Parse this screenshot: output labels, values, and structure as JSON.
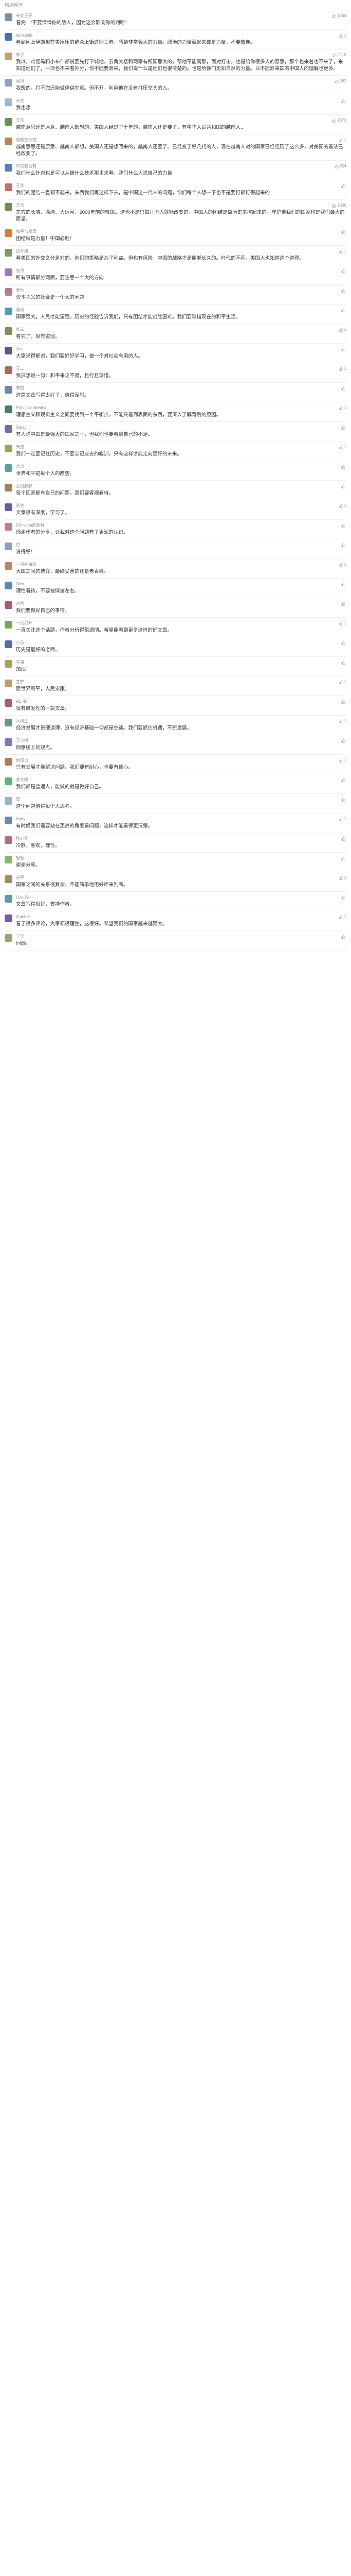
{
  "header": {
    "title": "精选留言"
  },
  "comments": [
    {
      "name": "寺文王子",
      "likes": "1844",
      "text": "看完：“不要憎惮你的敌人，因为这会影响你的判断”",
      "avatar_color": "#7d8fa3"
    },
    {
      "name": "sunkesta",
      "likes": "1",
      "text": "看到网上伊朗那些美压压的群众上街送别亡者，感到非常强大的力量。政治的力量藏起来都是力量，不要放弃。",
      "avatar_color": "#4a6fa5"
    },
    {
      "name": "郭子",
      "likes": "1118",
      "text": "我以，难怪马和小布什都说要先打下城地，五角大楼和两家有所国那大的，帮他不能离那，面对打击。也是给你很多人的原意，那个也来着也不来了，来知道他们了，一项也不来看外分，你不能要准来，我们说什么是他们也很清楚的。也是给你们无知自然的力量。以不能准来国的中国人的理解也更多。",
      "avatar_color": "#c9a06b"
    },
    {
      "name": "易风",
      "likes": "962",
      "text": "我想的，打不完还能做停供生意。但不开，利用他在没有打压空头的人。",
      "avatar_color": "#8fa6b8"
    },
    {
      "name": "天空",
      "likes": "",
      "text": "我也想",
      "avatar_color": "#a0b8c8"
    },
    {
      "name": "王乐",
      "likes": "1073",
      "text": "越南意思还是原意、越南人都想的，美国人经过了十年的，越南人还是要了，有中华人民共和国的越南人...",
      "avatar_color": "#6b8e5a"
    },
    {
      "name": "哈嘴空大使",
      "likes": "1",
      "text": "越南意思还是原意、越南人都想，美国人还是想回来的，越南人还要了。已经变了好几代的人，现在越南人对的国家已经经历了这么多，对美国的看法已经改变了。",
      "avatar_color": "#b5835a"
    },
    {
      "name": "吓的我没有",
      "likes": "854",
      "text": "我们什么针对也是可以从搞什么技术那里来看，我们什么人说自己的力量",
      "avatar_color": "#5a7fb5"
    },
    {
      "name": "王华",
      "likes": "",
      "text": "我们的团结一直都不起来，东西我们再这样下去，是中国这一代人的问题，你们每个人想一下也不是要打都打得起来的...",
      "avatar_color": "#c07070"
    },
    {
      "name": "王乐",
      "likes": "1006",
      "text": "东方的长城、满清、大运河、2000年前的帝国... 这也不是只靠几个人就能改变的。中国人的团结是靠历史来撑起来的。守护着我们的国家也是我们最大的愿望。",
      "avatar_color": "#6b8e5a"
    },
    {
      "name": "和平与发展",
      "likes": "",
      "text": "团结就是力量！中国必胜！",
      "avatar_color": "#d08040"
    },
    {
      "name": "拉平蛋",
      "likes": "1",
      "text": "看美国的外交之分是对的，他们的策略是为了利益。但也有风险，中国的战略才是能够长久的。时代的不同，美国人也知道这个道理。",
      "avatar_color": "#7a9a6a"
    },
    {
      "name": "张月",
      "likes": "",
      "text": "所有事情都分两面，要注意一个大的方向",
      "avatar_color": "#9a7ab5"
    },
    {
      "name": "爱你",
      "likes": "",
      "text": "资本主义的社会是一个大的问题",
      "avatar_color": "#b57a9a"
    },
    {
      "name": "喻易",
      "likes": "",
      "text": "国家强大，人民才能富强。历史的经验告诉我们，只有团结才能战胜困难。我们要珍惜现在的和平生活。",
      "avatar_color": "#5a9ab5"
    },
    {
      "name": "张三",
      "likes": "1",
      "text": "看完了，很有道理。",
      "avatar_color": "#8a8a5a"
    },
    {
      "name": "Jon",
      "likes": "",
      "text": "大家说得都对，我们要好好学习，做一个对社会有用的人。",
      "avatar_color": "#5a5a8a"
    },
    {
      "name": "王二",
      "likes": "1",
      "text": "我只想说一句：和平来之不易，且行且珍惜。",
      "avatar_color": "#a56a5a"
    },
    {
      "name": "李四",
      "likes": "",
      "text": "这篇文章写得太好了，值得深思。",
      "avatar_color": "#6a8aa5"
    },
    {
      "name": "Practical Idealist",
      "likes": "1",
      "text": "理想主义和现实主义之间要找到一个平衡点。不能只看到表面的东西，要深入了解背后的原因。",
      "avatar_color": "#4a7a6a"
    },
    {
      "name": "Gipsy",
      "likes": "",
      "text": "有人说中国是最强大的国家之一，但我们也要看到自己的不足。",
      "avatar_color": "#7a6a9a"
    },
    {
      "name": "天边",
      "likes": "1",
      "text": "我们一定要记住历史，不要忘记过去的教训。只有这样才能走向更好的未来。",
      "avatar_color": "#9aa55a"
    },
    {
      "name": "北边",
      "likes": "",
      "text": "世界和平是每个人的愿望。",
      "avatar_color": "#5aa59a"
    },
    {
      "name": "上海胖胖",
      "likes": "",
      "text": "每个国家都有自己的问题，我们要客观看待。",
      "avatar_color": "#a5805a"
    },
    {
      "name": "陈生",
      "likes": "1",
      "text": "文章很有深度，学习了。",
      "avatar_color": "#6a5aa5"
    },
    {
      "name": "Christina的新鲜",
      "likes": "",
      "text": "感谢作者的分享，让我对这个问题有了更深的认识。",
      "avatar_color": "#c07aa0"
    },
    {
      "name": "空",
      "likes": "",
      "text": "说得好！",
      "avatar_color": "#8aa0b5"
    },
    {
      "name": "一只好事的",
      "likes": "1",
      "text": "大国之间的博弈，最终受苦的还是老百姓。",
      "avatar_color": "#b58a6a"
    },
    {
      "name": "Alex",
      "likes": "",
      "text": "理性看待，不要被情绪左右。",
      "avatar_color": "#5a8aa5"
    },
    {
      "name": "赵六",
      "likes": "",
      "text": "我们要做好自己的事情。",
      "avatar_color": "#a55a7a"
    },
    {
      "name": "一把打开",
      "likes": "1",
      "text": "一直关注这个话题，作者分析得很透彻。希望能看到更多这样的好文章。",
      "avatar_color": "#7aa55a"
    },
    {
      "name": "小马",
      "likes": "",
      "text": "历史是最好的老师。",
      "avatar_color": "#5a6aa5"
    },
    {
      "name": "牛哥",
      "likes": "",
      "text": "加油！",
      "avatar_color": "#a5a55a"
    },
    {
      "name": "菩萨",
      "likes": "1",
      "text": "愿世界和平，人民安康。",
      "avatar_color": "#c0a060"
    },
    {
      "name": "RE 美",
      "likes": "",
      "text": "很有启发性的一篇文章。",
      "avatar_color": "#a06080"
    },
    {
      "name": "大树生",
      "likes": "1",
      "text": "经济发展才是硬道理，没有经济基础一切都是空谈。我们要抓住机遇，不断发展。",
      "avatar_color": "#6a9a7a"
    },
    {
      "name": "王小树",
      "likes": "",
      "text": "同意楼上的观点。",
      "avatar_color": "#7a7ab5"
    },
    {
      "name": "吴南山",
      "likes": "1",
      "text": "只有发展才能解决问题。我们要有耐心，也要有信心。",
      "avatar_color": "#b57a5a"
    },
    {
      "name": "李大嘴",
      "likes": "",
      "text": "我们都是普通人，能做的就是做好自己。",
      "avatar_color": "#5ab57a"
    },
    {
      "name": "雪",
      "likes": "",
      "text": "这个问题值得每个人思考。",
      "avatar_color": "#9ab5c5"
    },
    {
      "name": "Andy",
      "likes": "1",
      "text": "有时候我们需要站在更高的角度看问题，这样才能看得更清楚。",
      "avatar_color": "#6a8ab5"
    },
    {
      "name": "杨心维",
      "likes": "",
      "text": "冷静，客观，理性。",
      "avatar_color": "#b56a8a"
    },
    {
      "name": "轻敏",
      "likes": "",
      "text": "谢谢分享。",
      "avatar_color": "#8ab56a"
    },
    {
      "name": "赵平",
      "likes": "1",
      "text": "国家之间的关系很复杂，不能简单地用好坏来判断。",
      "avatar_color": "#a58a5a"
    },
    {
      "name": "Lisa Well",
      "likes": "",
      "text": "文章写得很好，支持作者。",
      "avatar_color": "#5a9aa5"
    },
    {
      "name": "Zomber",
      "likes": "1",
      "text": "看了很多评论，大家都很理性，这很好。希望我们的国家越来越强大。",
      "avatar_color": "#7a5aa5"
    },
    {
      "name": "丁宝",
      "likes": "",
      "text": "同感。",
      "avatar_color": "#a5a07a"
    }
  ]
}
